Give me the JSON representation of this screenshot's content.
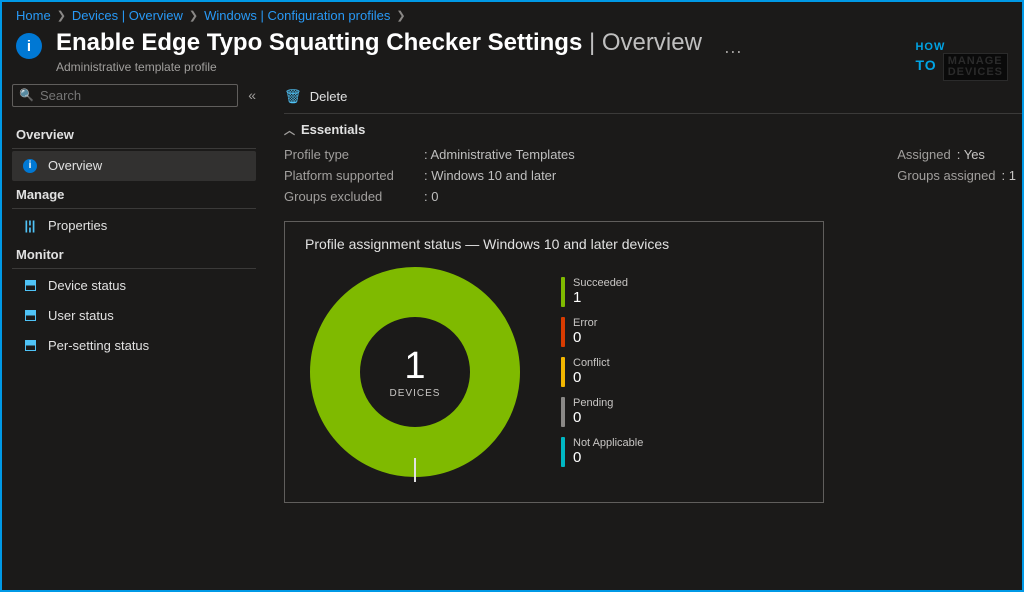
{
  "breadcrumb": [
    "Home",
    "Devices | Overview",
    "Windows | Configuration profiles"
  ],
  "header": {
    "title": "Enable Edge Typo Squatting Checker Settings",
    "title_suffix": "Overview",
    "subtitle": "Administrative template profile",
    "info_glyph": "i",
    "more_glyph": "···"
  },
  "logo": {
    "how": "HOW",
    "to": "TO",
    "manage": "MANAGE",
    "devices": "DEVICES"
  },
  "search": {
    "placeholder": "Search",
    "icon": "🔍",
    "collapse": "«"
  },
  "sidebar": {
    "sections": [
      {
        "label": "Overview",
        "items": [
          {
            "label": "Overview",
            "icon": "overview",
            "active": true
          }
        ]
      },
      {
        "label": "Manage",
        "items": [
          {
            "label": "Properties",
            "icon": "props"
          }
        ]
      },
      {
        "label": "Monitor",
        "items": [
          {
            "label": "Device status",
            "icon": "monitor"
          },
          {
            "label": "User status",
            "icon": "monitor"
          },
          {
            "label": "Per-setting status",
            "icon": "monitor"
          }
        ]
      }
    ]
  },
  "toolbar": {
    "delete_icon": "🗑",
    "delete_label": "Delete"
  },
  "essentials": {
    "heading": "Essentials",
    "left": [
      {
        "label": "Profile type",
        "value": "Administrative Templates"
      },
      {
        "label": "Platform supported",
        "value": "Windows 10 and later"
      },
      {
        "label": "Groups excluded",
        "value": "0"
      }
    ],
    "right": [
      {
        "label": "Assigned",
        "value": "Yes"
      },
      {
        "label": "Groups assigned",
        "value": "1"
      }
    ]
  },
  "chart_data": {
    "type": "pie",
    "title": "Profile assignment status — Windows 10 and later devices",
    "center_value": "1",
    "center_label": "DEVICES",
    "series": [
      {
        "name": "Succeeded",
        "value": 1,
        "color": "#7fba00"
      },
      {
        "name": "Error",
        "value": 0,
        "color": "#d83b01"
      },
      {
        "name": "Conflict",
        "value": 0,
        "color": "#f2b600"
      },
      {
        "name": "Pending",
        "value": 0,
        "color": "#8a8886"
      },
      {
        "name": "Not Applicable",
        "value": 0,
        "color": "#00b7c3"
      }
    ]
  }
}
